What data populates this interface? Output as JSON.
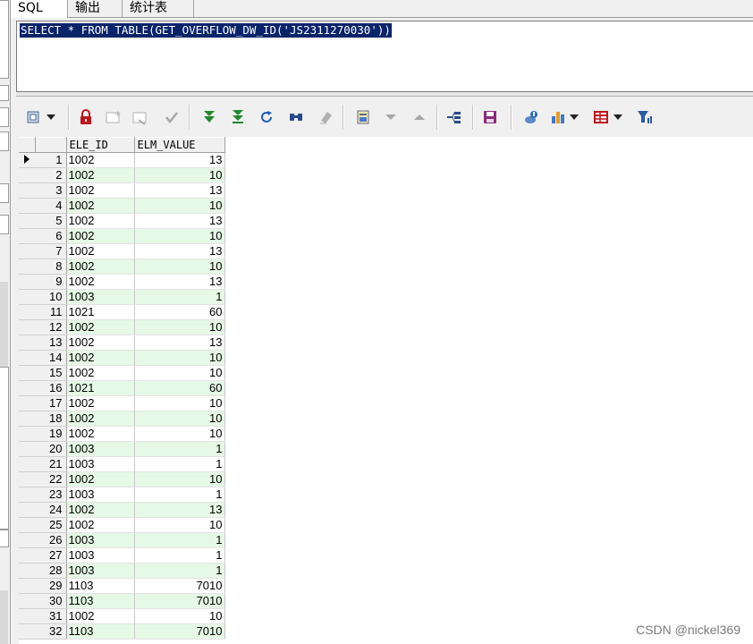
{
  "tabs": [
    {
      "label": "SQL",
      "active": true
    },
    {
      "label": "输出",
      "active": false
    },
    {
      "label": "统计表",
      "active": false
    }
  ],
  "editor": {
    "sql": "SELECT * FROM TABLE(GET_OVERFLOW_DW_ID('JS2311270030'))"
  },
  "toolbar": {
    "icons": [
      "select-mode-icon",
      "dropdown-arrow-icon",
      "lock-icon",
      "insert-record-icon",
      "delete-record-icon",
      "post-changes-icon",
      "fetch-next-page-icon",
      "fetch-last-page-icon",
      "refresh-icon",
      "find-icon",
      "clear-icon",
      "query-by-example-icon",
      "next-record-icon",
      "previous-record-icon",
      "single-record-view-icon",
      "save-icon",
      "export-icon",
      "chart-icon",
      "grid-options-icon",
      "filter-icon"
    ]
  },
  "grid": {
    "columns": [
      "ELE_ID",
      "ELM_VALUE"
    ],
    "rows": [
      [
        "1",
        "1002",
        "13"
      ],
      [
        "2",
        "1002",
        "10"
      ],
      [
        "3",
        "1002",
        "13"
      ],
      [
        "4",
        "1002",
        "10"
      ],
      [
        "5",
        "1002",
        "13"
      ],
      [
        "6",
        "1002",
        "10"
      ],
      [
        "7",
        "1002",
        "13"
      ],
      [
        "8",
        "1002",
        "10"
      ],
      [
        "9",
        "1002",
        "13"
      ],
      [
        "10",
        "1003",
        "1"
      ],
      [
        "11",
        "1021",
        "60"
      ],
      [
        "12",
        "1002",
        "10"
      ],
      [
        "13",
        "1002",
        "13"
      ],
      [
        "14",
        "1002",
        "10"
      ],
      [
        "15",
        "1002",
        "10"
      ],
      [
        "16",
        "1021",
        "60"
      ],
      [
        "17",
        "1002",
        "10"
      ],
      [
        "18",
        "1002",
        "10"
      ],
      [
        "19",
        "1002",
        "10"
      ],
      [
        "20",
        "1003",
        "1"
      ],
      [
        "21",
        "1003",
        "1"
      ],
      [
        "22",
        "1002",
        "10"
      ],
      [
        "23",
        "1003",
        "1"
      ],
      [
        "24",
        "1002",
        "13"
      ],
      [
        "25",
        "1002",
        "10"
      ],
      [
        "26",
        "1003",
        "1"
      ],
      [
        "27",
        "1003",
        "1"
      ],
      [
        "28",
        "1003",
        "1"
      ],
      [
        "29",
        "1103",
        "7010"
      ],
      [
        "30",
        "1103",
        "7010"
      ],
      [
        "31",
        "1002",
        "10"
      ],
      [
        "32",
        "1103",
        "7010"
      ]
    ],
    "current_row": 1
  },
  "watermark": "CSDN @nickel369",
  "colors": {
    "selection": "#0a246a",
    "alt_row": "#e6f9e6",
    "icon_green": "#1e8a2a",
    "icon_red": "#c0141c",
    "icon_blue": "#1d5fb8"
  }
}
